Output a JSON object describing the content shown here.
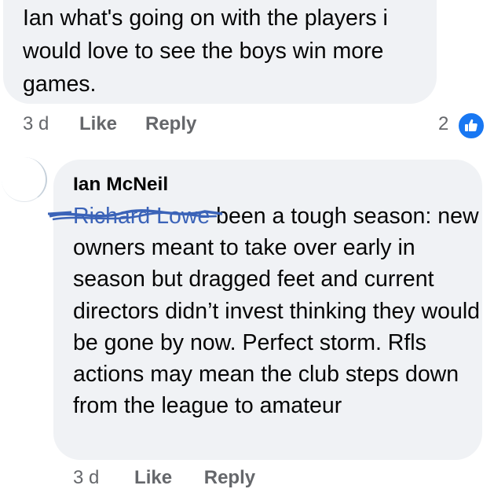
{
  "comment1": {
    "text": "Ian what's going on with the players i would love to see the boys win more games.",
    "time": "3 d",
    "like_label": "Like",
    "reply_label": "Reply",
    "reaction_count": "2",
    "reaction_icon": "thumbs-up-icon",
    "accent_color": "#1877f2"
  },
  "reply1": {
    "author": "Ian McNeil",
    "mention": "Richard Lowe",
    "text": " been a tough season: new owners meant to take over early in season but dragged feet and current directors didn’t invest thinking they would be gone by now. Perfect storm. Rfls actions may mean the club steps down from the league to amateur",
    "time": "3 d",
    "like_label": "Like",
    "reply_label": "Reply"
  }
}
